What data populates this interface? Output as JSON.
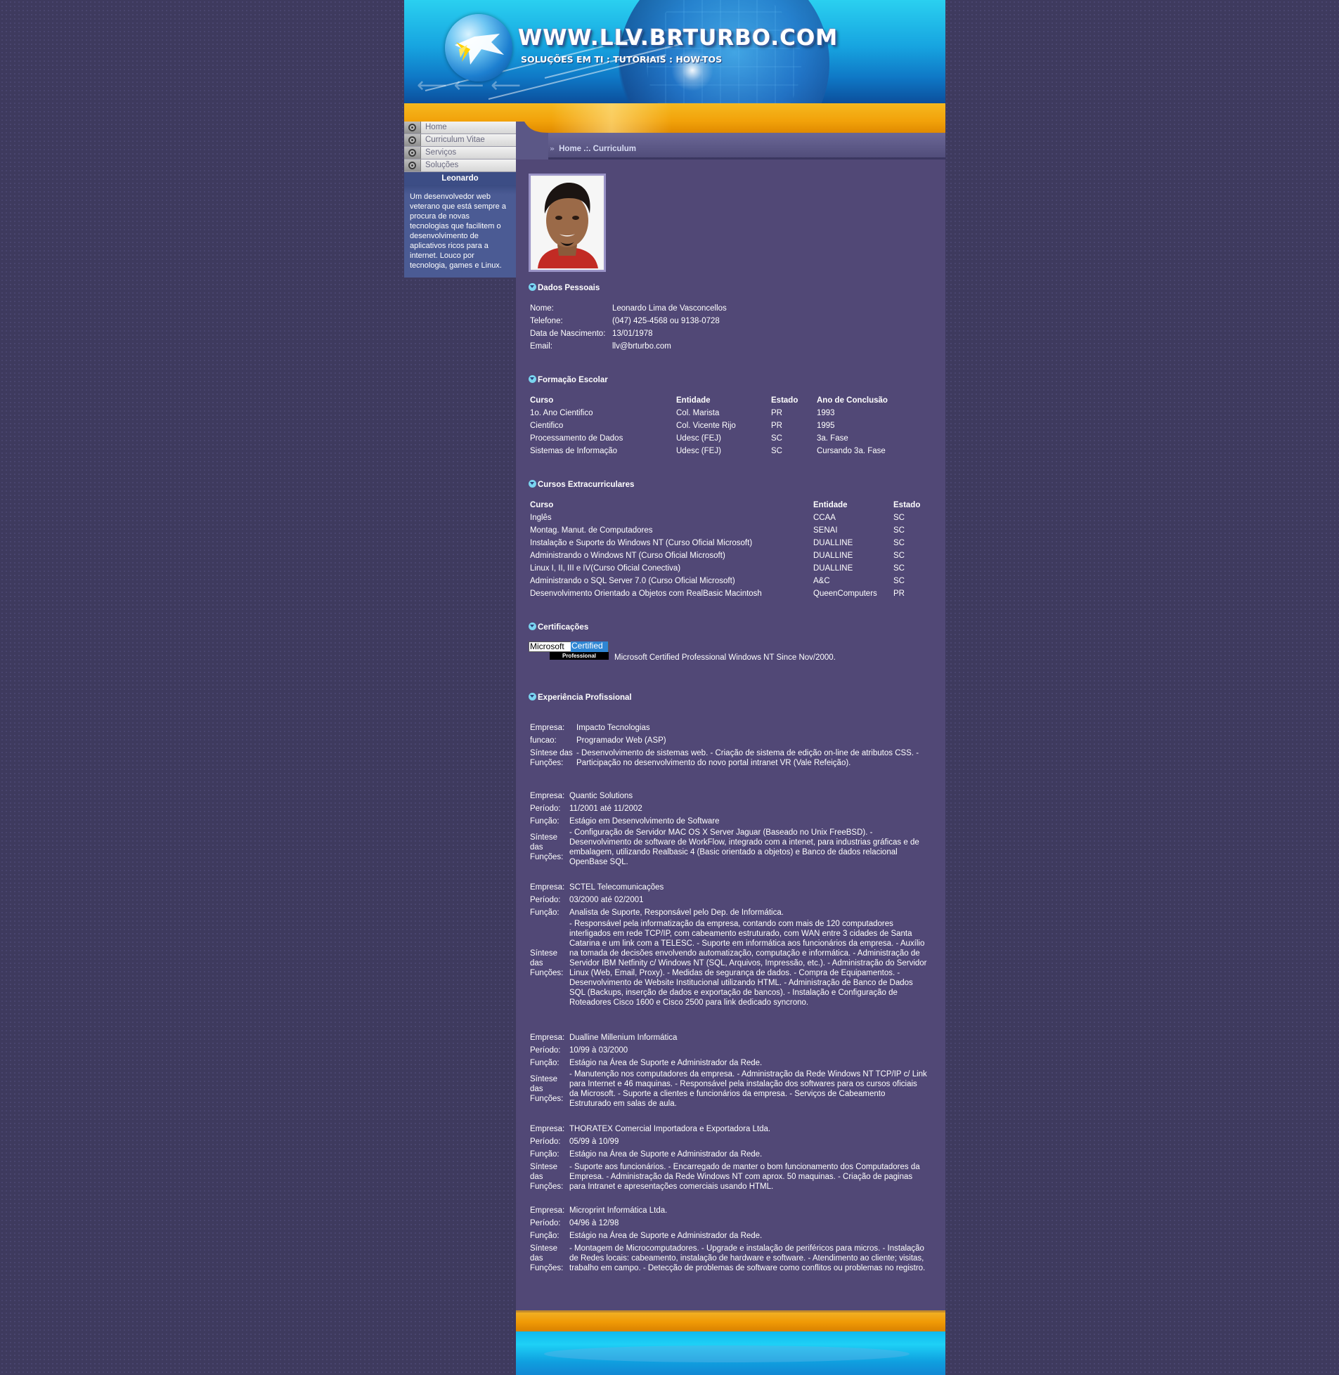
{
  "header": {
    "site_url": "WWW.LLV.BRTURBO.COM",
    "tagline": "SOLUÇÕES EM TI : TUTORIAIS : HOW-TOS"
  },
  "nav": {
    "items": [
      {
        "label": "Home"
      },
      {
        "label": "Curriculum Vitae"
      },
      {
        "label": "Serviços"
      },
      {
        "label": "Soluções"
      }
    ]
  },
  "profile": {
    "name": "Leonardo",
    "bio": "Um desenvolvedor web veterano que está sempre a procura de novas tecnologias que facilitem o desenvolvimento de aplicativos ricos para a internet. Louco por tecnologia, games e Linux."
  },
  "breadcrumb": "Home .:. Curriculum",
  "dados_pessoais": {
    "title": "Dados Pessoais",
    "rows": [
      {
        "label": "Nome:",
        "value": "Leonardo Lima de Vasconcellos"
      },
      {
        "label": "Telefone:",
        "value": "(047) 425-4568 ou 9138-0728"
      },
      {
        "label": "Data de Nascimento:",
        "value": "13/01/1978"
      },
      {
        "label": "Email:",
        "value": "llv@brturbo.com"
      }
    ]
  },
  "formacao": {
    "title": "Formação Escolar",
    "headers": [
      "Curso",
      "Entidade",
      "Estado",
      "Ano de Conclusão"
    ],
    "rows": [
      [
        "1o. Ano Cientifico",
        "Col. Marista",
        "PR",
        "1993"
      ],
      [
        "Cientifico",
        "Col. Vicente Rijo",
        "PR",
        "1995"
      ],
      [
        "Processamento de Dados",
        "Udesc (FEJ)",
        "SC",
        "3a. Fase"
      ],
      [
        "Sistemas de Informação",
        "Udesc (FEJ)",
        "SC",
        "Cursando 3a. Fase"
      ]
    ]
  },
  "extracurriculares": {
    "title": "Cursos Extracurriculares",
    "headers": [
      "Curso",
      "Entidade",
      "Estado"
    ],
    "rows": [
      [
        "Inglês",
        "CCAA",
        "SC"
      ],
      [
        "Montag. Manut. de Computadores",
        "SENAI",
        "SC"
      ],
      [
        "Instalação e Suporte do Windows NT (Curso Oficial Microsoft)",
        "DUALLINE",
        "SC"
      ],
      [
        "Administrando o Windows NT (Curso Oficial Microsoft)",
        "DUALLINE",
        "SC"
      ],
      [
        "Linux I, II, III e IV(Curso Oficial Conectiva)",
        "DUALLINE",
        "SC"
      ],
      [
        "Administrando o SQL Server 7.0 (Curso Oficial Microsoft)",
        "A&C",
        "SC"
      ],
      [
        "Desenvolvimento Orientado a Objetos com RealBasic Macintosh",
        "QueenComputers",
        "PR"
      ]
    ]
  },
  "certificacoes": {
    "title": "Certificações",
    "badge_ms": "Microsoft",
    "badge_certified": "Certified",
    "badge_professional": "Professional",
    "text": "Microsoft Certified Professional Windows NT Since Nov/2000."
  },
  "experiencia": {
    "title": "Experiência Profissional",
    "first": {
      "empresa_label": "Empresa:",
      "empresa": "Impacto Tecnologias",
      "funcao_label": "funcao:",
      "funcao": "Programador Web (ASP)",
      "sintese_label": "Síntese das Funções:",
      "sintese": "- Desenvolvimento de sistemas web. - Criação de sistema de edição on-line de atributos CSS. - Participação no desenvolvimento do novo portal intranet VR (Vale Refeição)."
    },
    "jobs": [
      {
        "empresa": "Quantic Solutions",
        "periodo": "11/2001 até 11/2002",
        "funcao": "Estágio em Desenvolvimento de Software",
        "sintese": "- Configuração de Servidor MAC OS X Server Jaguar (Baseado no Unix FreeBSD). - Desenvolvimento de software de WorkFlow, integrado com a intenet, para industrias gráficas e de embalagem, utilizando Realbasic 4 (Basic orientado a objetos) e Banco de dados relacional OpenBase SQL."
      },
      {
        "empresa": "SCTEL Telecomunicações",
        "periodo": "03/2000 até 02/2001",
        "funcao": "Analista de Suporte, Responsável pelo Dep. de Informática.",
        "sintese": "- Responsável pela informatização da empresa, contando com mais de 120 computadores interligados em rede TCP/IP, com cabeamento estruturado, com WAN entre 3 cidades de Santa Catarina e um link com a TELESC. - Suporte em informática aos funcionários da empresa. - Auxílio na tomada de decisões envolvendo automatização, computação e informática. - Administração de Servidor IBM Netfinity c/ Windows NT (SQL, Arquivos, Impressão, etc.). - Administração do Servidor Linux (Web, Email, Proxy). - Medidas de segurança de dados. - Compra de Equipamentos. - Desenvolvimento de Website Institucional utilizando HTML. - Administração de Banco de Dados SQL (Backups, inserção de dados e exportação de bancos). - Instalação e Configuração de Roteadores Cisco 1600 e Cisco 2500 para link dedicado syncrono."
      },
      {
        "empresa": "Dualline Millenium Informática",
        "periodo": "10/99 à 03/2000",
        "funcao": "Estágio na Área de Suporte e Administrador da Rede.",
        "sintese": "- Manutenção nos computadores da empresa. - Administração da Rede Windows NT TCP/IP c/ Link para Internet e 46 maquinas. - Responsável pela instalação dos softwares para os cursos oficiais da Microsoft. - Suporte a clientes e funcionários da empresa. - Serviços de Cabeamento Estruturado em salas de aula."
      },
      {
        "empresa": "THORATEX Comercial Importadora e Exportadora Ltda.",
        "periodo": "05/99 à 10/99",
        "funcao": "Estágio na Área de Suporte e Administrador da Rede.",
        "sintese": "- Suporte aos funcionários. - Encarregado de manter o bom funcionamento dos Computadores da Empresa. - Administração da Rede Windows NT com aprox. 50 maquinas. - Criação de paginas para Intranet e apresentações comerciais usando HTML."
      },
      {
        "empresa": "Microprint Informática Ltda.",
        "periodo": "04/96 à 12/98",
        "funcao": "Estágio na Área de Suporte e Administrador da Rede.",
        "sintese": "- Montagem de Microcomputadores. - Upgrade e instalação de periféricos para micros. - Instalação de Redes locais: cabeamento, instalação de hardware e software. - Atendimento ao cliente; visitas, trabalho em campo. - Detecção de problemas de software como conflitos ou problemas no registro."
      }
    ],
    "labels": {
      "empresa": "Empresa:",
      "periodo": "Período:",
      "funcao": "Função:",
      "sintese": "Síntese das Funções:"
    }
  }
}
